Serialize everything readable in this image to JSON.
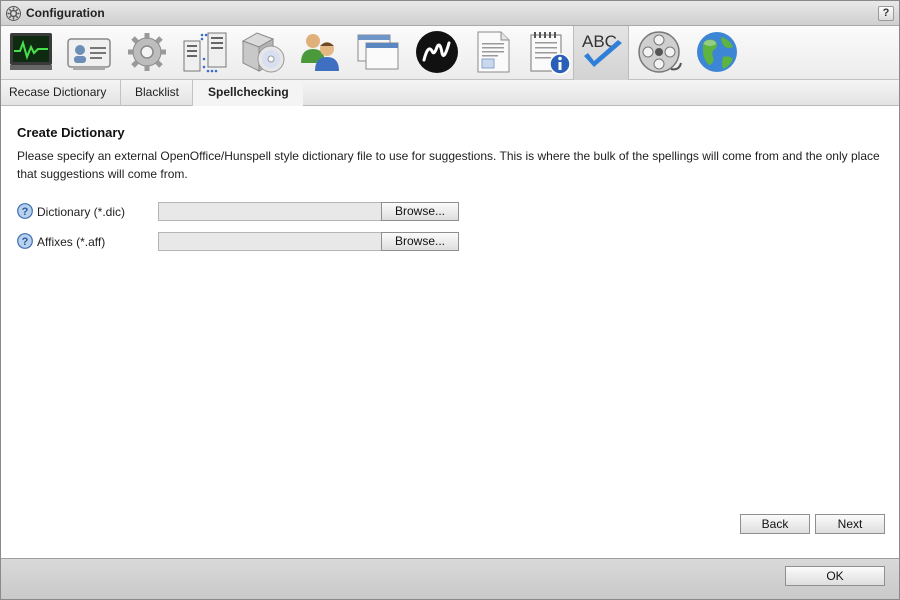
{
  "window": {
    "title": "Configuration",
    "help_label": "?"
  },
  "toolbar": {
    "icons": [
      {
        "name": "monitor-activity-icon"
      },
      {
        "name": "id-card-icon"
      },
      {
        "name": "settings-gear-icon"
      },
      {
        "name": "network-servers-icon"
      },
      {
        "name": "software-box-icon"
      },
      {
        "name": "users-icon"
      },
      {
        "name": "windows-icon"
      },
      {
        "name": "m-logo-icon"
      },
      {
        "name": "document-icon"
      },
      {
        "name": "notepad-info-icon"
      },
      {
        "name": "spellcheck-abc-icon",
        "selected": true,
        "text": "ABC"
      },
      {
        "name": "film-reel-icon"
      },
      {
        "name": "globe-icon"
      }
    ]
  },
  "subtabs": {
    "items": [
      {
        "label": "Recase Dictionary"
      },
      {
        "label": "Blacklist"
      },
      {
        "label": "Spellchecking",
        "active": true
      }
    ]
  },
  "main": {
    "heading": "Create Dictionary",
    "description": "Please specify an external OpenOffice/Hunspell style dictionary file to use for suggestions. This is where the bulk of the spellings will come from and the only place that suggestions will come from.",
    "fields": [
      {
        "label": "Dictionary (*.dic)",
        "value": "",
        "button": "Browse..."
      },
      {
        "label": "Affixes (*.aff)",
        "value": "",
        "button": "Browse..."
      }
    ],
    "back_label": "Back",
    "next_label": "Next"
  },
  "footer": {
    "ok_label": "OK"
  },
  "colors": {
    "check_blue": "#2f7fd8",
    "help_blue": "#3a6fb0"
  }
}
